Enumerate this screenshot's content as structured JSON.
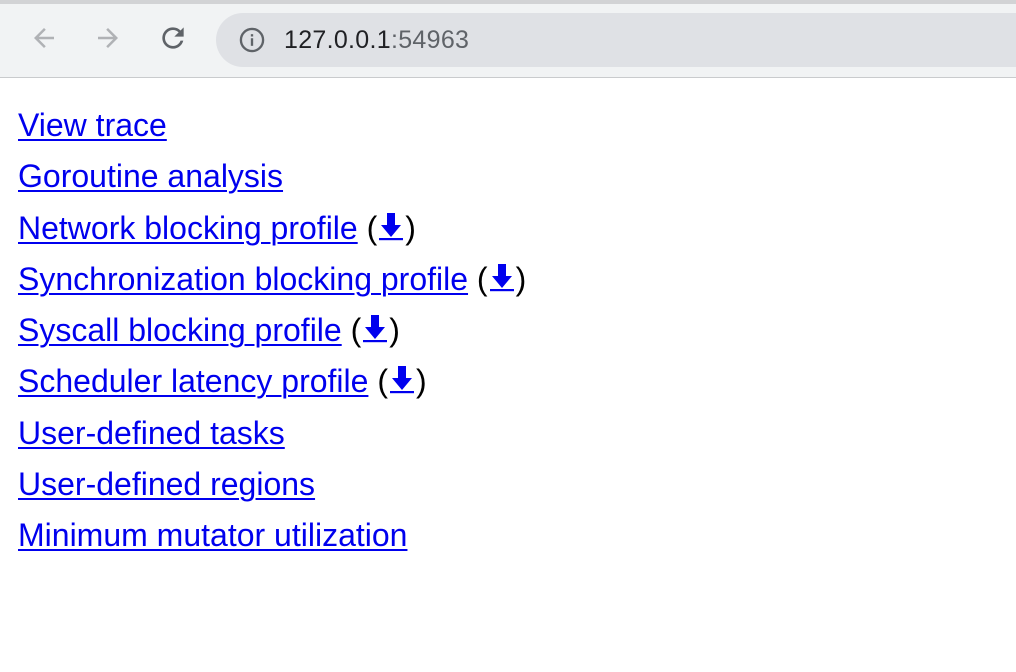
{
  "browser": {
    "url_host": "127.0.0.1",
    "url_port": ":54963"
  },
  "links": [
    {
      "label": "View trace",
      "download": false
    },
    {
      "label": "Goroutine analysis",
      "download": false
    },
    {
      "label": "Network blocking profile",
      "download": true
    },
    {
      "label": "Synchronization blocking profile",
      "download": true
    },
    {
      "label": "Syscall blocking profile",
      "download": true
    },
    {
      "label": "Scheduler latency profile",
      "download": true
    },
    {
      "label": "User-defined tasks",
      "download": false
    },
    {
      "label": "User-defined regions",
      "download": false
    },
    {
      "label": "Minimum mutator utilization",
      "download": false
    }
  ],
  "download_open": "(",
  "download_close": ")",
  "colors": {
    "link": "#0000ee",
    "toolbar": "#f1f3f4",
    "omnibox": "#dfe1e5"
  },
  "icons": {
    "back": "arrow-left-icon",
    "forward": "arrow-right-icon",
    "reload": "reload-icon",
    "site_info": "info-icon",
    "download": "download-arrow-icon"
  }
}
